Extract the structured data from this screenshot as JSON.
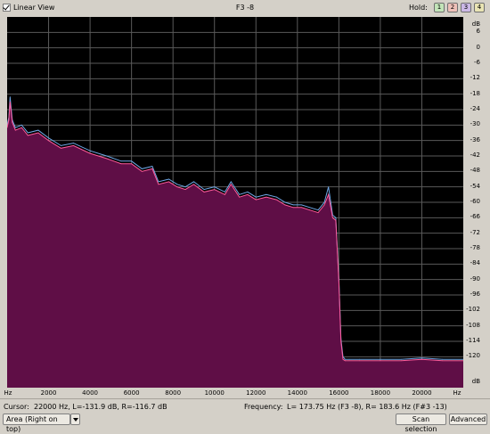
{
  "toolbar": {
    "linear_view_label": "Linear View",
    "linear_view_checked": true,
    "title": "F3 -8",
    "hold_label": "Hold:",
    "hold_buttons": [
      {
        "label": "1",
        "color": "#c2e4b8"
      },
      {
        "label": "2",
        "color": "#eec0b8"
      },
      {
        "label": "3",
        "color": "#cbb8e6"
      },
      {
        "label": "4",
        "color": "#e9e4b3"
      }
    ]
  },
  "chart_data": {
    "type": "area",
    "y_axis": {
      "unit": "dB",
      "ticks": [
        "6",
        "0",
        "-6",
        "-12",
        "-18",
        "-24",
        "-30",
        "-36",
        "-42",
        "-48",
        "-54",
        "-60",
        "-66",
        "-72",
        "-78",
        "-84",
        "-90",
        "-96",
        "-102",
        "-108",
        "-114",
        "-120"
      ],
      "range": [
        12,
        -132
      ]
    },
    "x_axis": {
      "unit": "Hz",
      "ticks": [
        "2000",
        "4000",
        "6000",
        "8000",
        "10000",
        "12000",
        "14000",
        "16000",
        "18000",
        "20000"
      ],
      "range": [
        0,
        22000
      ]
    },
    "series": [
      {
        "color": "#6fa7e6",
        "x": [
          0,
          80,
          140,
          250,
          400,
          700,
          1000,
          1500,
          2000,
          2600,
          3200,
          4000,
          4800,
          5500,
          6000,
          6500,
          7000,
          7300,
          7800,
          8200,
          8600,
          9000,
          9500,
          10000,
          10500,
          10800,
          11200,
          11600,
          12000,
          12500,
          13000,
          13400,
          13800,
          14200,
          14600,
          15000,
          15300,
          15500,
          15700,
          15850,
          16000,
          16100,
          16200,
          16300,
          16500,
          17000,
          18000,
          19000,
          20000,
          21000,
          22000
        ],
        "y": [
          -30,
          -27,
          -19,
          -28,
          -31,
          -30,
          -33,
          -32,
          -35,
          -38,
          -37,
          -40,
          -42,
          -44,
          -44,
          -47,
          -46,
          -52,
          -51,
          -53,
          -54,
          -52,
          -55,
          -54,
          -56,
          -52,
          -57,
          -56,
          -58,
          -57,
          -58,
          -60,
          -61,
          -61,
          -62,
          -63,
          -60,
          -54,
          -65,
          -66,
          -90,
          -113,
          -120,
          -121,
          -121,
          -121,
          -121,
          -121,
          -120.5,
          -121,
          -121
        ]
      },
      {
        "color": "#ff5a9a",
        "x": [
          0,
          80,
          140,
          250,
          400,
          700,
          1000,
          1500,
          2000,
          2600,
          3200,
          4000,
          4800,
          5500,
          6000,
          6500,
          7000,
          7300,
          7800,
          8200,
          8600,
          9000,
          9500,
          10000,
          10500,
          10800,
          11200,
          11600,
          12000,
          12500,
          13000,
          13400,
          13800,
          14200,
          14600,
          15000,
          15300,
          15500,
          15700,
          15850,
          16000,
          16100,
          16200,
          16300,
          16500,
          17000,
          18000,
          19000,
          20000,
          21000,
          22000
        ],
        "y": [
          -31,
          -28,
          -21,
          -29,
          -32,
          -31,
          -34,
          -33,
          -36,
          -39,
          -38,
          -41,
          -43,
          -45,
          -45,
          -48,
          -47,
          -53,
          -52,
          -54,
          -55,
          -53,
          -56,
          -55,
          -57,
          -53,
          -58,
          -57,
          -59,
          -58,
          -59,
          -61,
          -62,
          -62,
          -63,
          -64,
          -61,
          -57,
          -66,
          -67,
          -91,
          -114,
          -121,
          -121.5,
          -121.5,
          -121.5,
          -121.5,
          -121.5,
          -121,
          -121.5,
          -121.5
        ]
      }
    ],
    "fill_color": "#5f0e46",
    "grid": true
  },
  "status": {
    "cursor_label": "Cursor:",
    "cursor_value": "22000 Hz, L=-131.9 dB, R=-116.7 dB",
    "frequency_label": "Frequency:",
    "frequency_value": "L= 173.75 Hz (F3 -8), R= 183.6 Hz (F#3 -13)"
  },
  "controls": {
    "area_dropdown": "Area (Right on top)",
    "scan_selection": "Scan selection",
    "advanced": "Advanced"
  }
}
